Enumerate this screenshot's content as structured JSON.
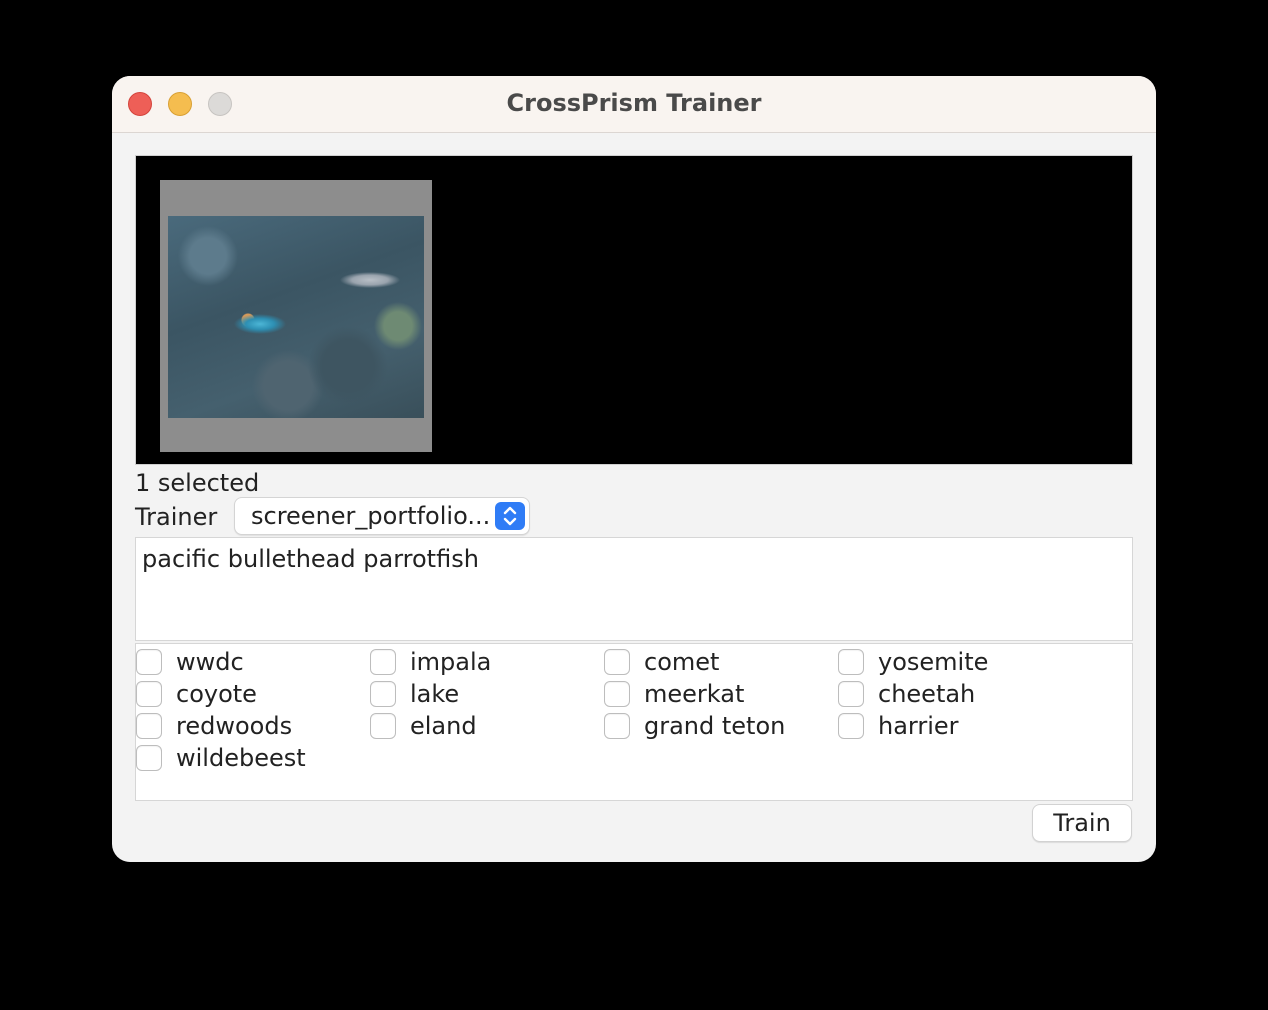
{
  "window": {
    "title": "CrossPrism Trainer"
  },
  "preview": {
    "selected_count": "1 selected"
  },
  "trainer": {
    "label": "Trainer",
    "selected_value": "screener_portfolio..."
  },
  "caption": {
    "value": "pacific bullethead parrotfish"
  },
  "labels": {
    "items": [
      {
        "label": "wwdc",
        "checked": false
      },
      {
        "label": "impala",
        "checked": false
      },
      {
        "label": "comet",
        "checked": false
      },
      {
        "label": "yosemite",
        "checked": false
      },
      {
        "label": "coyote",
        "checked": false
      },
      {
        "label": "lake",
        "checked": false
      },
      {
        "label": "meerkat",
        "checked": false
      },
      {
        "label": "cheetah",
        "checked": false
      },
      {
        "label": "redwoods",
        "checked": false
      },
      {
        "label": "eland",
        "checked": false
      },
      {
        "label": "grand teton",
        "checked": false
      },
      {
        "label": "harrier",
        "checked": false
      },
      {
        "label": "wildebeest",
        "checked": false
      }
    ]
  },
  "actions": {
    "train_label": "Train"
  },
  "colors": {
    "accent": "#2f7cf6",
    "close": "#ee5f57",
    "minimize": "#f5bd4f",
    "zoom_disabled": "#dcdad8"
  }
}
